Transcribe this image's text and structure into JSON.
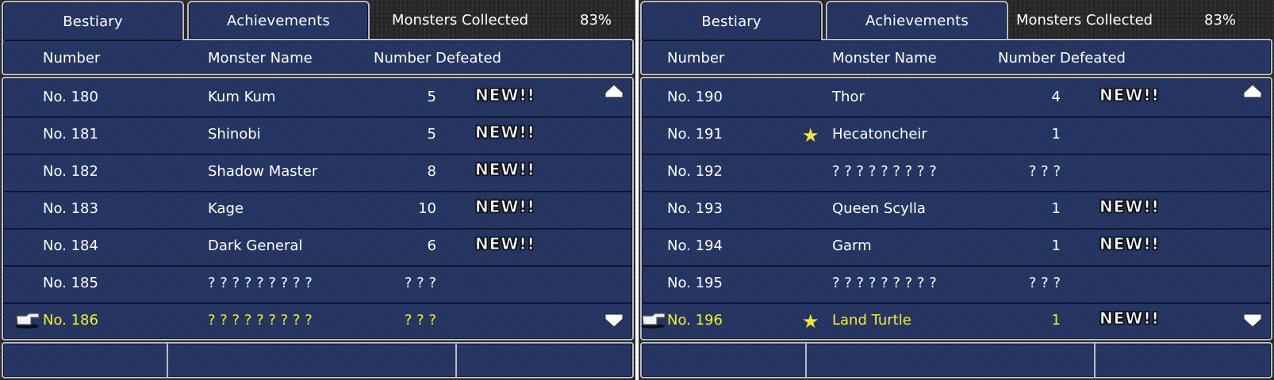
{
  "panels": [
    {
      "tabs": [
        "Bestiary",
        "Achievements"
      ],
      "collected_label": "Monsters Collected",
      "collected_value": "83%",
      "headers": [
        "Number",
        "Monster Name",
        "Number Defeated"
      ],
      "rows": [
        {
          "number": "No. 180",
          "name": "Kum Kum",
          "defeated": "5",
          "new": "NEW!!",
          "star": ""
        },
        {
          "number": "No. 181",
          "name": "Shinobi",
          "defeated": "5",
          "new": "NEW!!",
          "star": ""
        },
        {
          "number": "No. 182",
          "name": "Shadow Master",
          "defeated": "8",
          "new": "NEW!!",
          "star": ""
        },
        {
          "number": "No. 183",
          "name": "Kage",
          "defeated": "10",
          "new": "NEW!!",
          "star": ""
        },
        {
          "number": "No. 184",
          "name": "Dark General",
          "defeated": "6",
          "new": "NEW!!",
          "star": ""
        },
        {
          "number": "No. 185",
          "name": "? ? ? ? ? ? ? ? ?",
          "defeated": "? ? ?",
          "new": "",
          "star": ""
        },
        {
          "number": "No. 186",
          "name": "? ? ? ? ? ? ? ? ?",
          "defeated": "? ? ?",
          "new": "",
          "star": "",
          "selected": true
        }
      ]
    },
    {
      "tabs": [
        "Bestiary",
        "Achievements"
      ],
      "collected_label": "Monsters Collected",
      "collected_value": "83%",
      "headers": [
        "Number",
        "Monster Name",
        "Number Defeated"
      ],
      "rows": [
        {
          "number": "No. 190",
          "name": "Thor",
          "defeated": "4",
          "new": "NEW!!",
          "star": ""
        },
        {
          "number": "No. 191",
          "name": "Hecatoncheir",
          "defeated": "1",
          "new": "",
          "star": "★"
        },
        {
          "number": "No. 192",
          "name": "? ? ? ? ? ? ? ? ?",
          "defeated": "? ? ?",
          "new": "",
          "star": ""
        },
        {
          "number": "No. 193",
          "name": "Queen Scylla",
          "defeated": "1",
          "new": "NEW!!",
          "star": ""
        },
        {
          "number": "No. 194",
          "name": "Garm",
          "defeated": "1",
          "new": "NEW!!",
          "star": ""
        },
        {
          "number": "No. 195",
          "name": "? ? ? ? ? ? ? ? ?",
          "defeated": "? ? ?",
          "new": "",
          "star": ""
        },
        {
          "number": "No. 196",
          "name": "Land Turtle",
          "defeated": "1",
          "new": "NEW!!",
          "star": "★",
          "selected": true
        }
      ]
    }
  ],
  "icons": {
    "cursor": "pointing-hand-icon",
    "scroll_up": "scroll-up-arrow-icon",
    "scroll_down": "scroll-down-arrow-icon"
  },
  "colors": {
    "panel_blue": "#233462",
    "selected_text": "#f6ee2a",
    "star": "#f6e23a",
    "border": "#b9bcc6"
  }
}
